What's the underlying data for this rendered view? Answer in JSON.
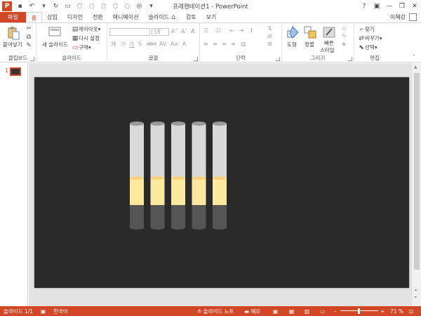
{
  "window": {
    "title": "프레젠테이션1 - PowerPoint",
    "help": "?",
    "minimize": "—",
    "restore": "❐",
    "close": "✕"
  },
  "tabs": [
    {
      "label": "파일"
    },
    {
      "label": "홈"
    },
    {
      "label": "삽입"
    },
    {
      "label": "디자인"
    },
    {
      "label": "전환"
    },
    {
      "label": "애니메이션"
    },
    {
      "label": "슬라이드 쇼"
    },
    {
      "label": "검토"
    },
    {
      "label": "보기"
    }
  ],
  "user": {
    "name": "이혜강"
  },
  "ribbon": {
    "clipboard": {
      "label": "클립보드",
      "paste": "붙여넣기"
    },
    "slides": {
      "label": "슬라이드",
      "new_slide": "새 슬라이드",
      "layout": "레이아웃",
      "reset": "다시 설정",
      "section": "구역"
    },
    "font": {
      "label": "글꼴",
      "font_size": "18"
    },
    "paragraph": {
      "label": "단락"
    },
    "drawing": {
      "label": "그리기",
      "shapes": "도형",
      "arrange": "정렬",
      "quick_styles_1": "빠른",
      "quick_styles_2": "스타일"
    },
    "editing": {
      "label": "편집",
      "find": "찾기",
      "replace": "바꾸기",
      "select": "선택"
    }
  },
  "thumbs": {
    "slide_number": "1"
  },
  "slide": {
    "cylinders": [
      {
        "level": 0.33
      },
      {
        "level": 0.33
      },
      {
        "level": 0.33
      },
      {
        "level": 0.33
      },
      {
        "level": 0.33
      }
    ],
    "colors": {
      "background": "#2a2a2a",
      "glass": "#d9d9d9",
      "liquid": "#fde8a0",
      "base": "#555555"
    }
  },
  "status": {
    "slide_info": "슬라이드 1/1",
    "language": "한국어",
    "notes": "슬라이드 노트",
    "comments": "메모",
    "zoom": "71 %"
  },
  "colors": {
    "accent": "#d24726"
  }
}
